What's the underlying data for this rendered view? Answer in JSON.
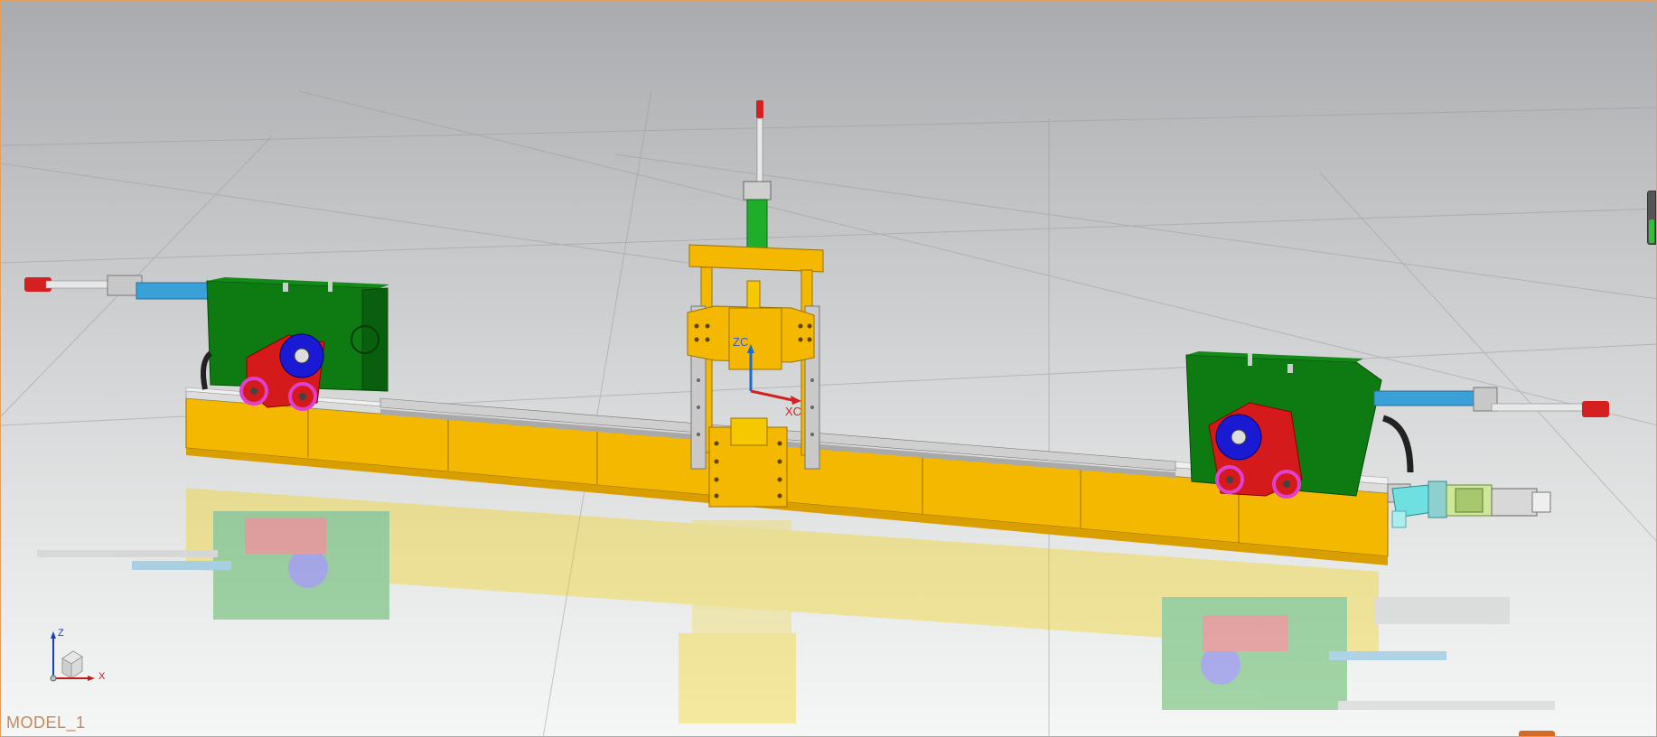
{
  "viewport": {
    "model_name": "MODEL_1",
    "background": "gradient-gray",
    "accent_color": "#e0a060"
  },
  "triad": {
    "z_label": "Z",
    "x_label": "X",
    "z_color": "#1a3cc0",
    "x_color": "#c01a1a"
  },
  "wcs": {
    "zc_label": "ZC",
    "xc_label": "XC"
  },
  "zoom_gauge": {
    "level_fraction": 0.44,
    "color": "#2fbf3a"
  },
  "model_colors": {
    "frame_yellow": "#f5b800",
    "housing_green": "#0d7a12",
    "cam_red": "#d41a1a",
    "cam_blue": "#1a1ad4",
    "cylinder_blue": "#3aa0d8",
    "bearing_magenta": "#e040d0",
    "cylinder_green": "#1fae2a"
  }
}
